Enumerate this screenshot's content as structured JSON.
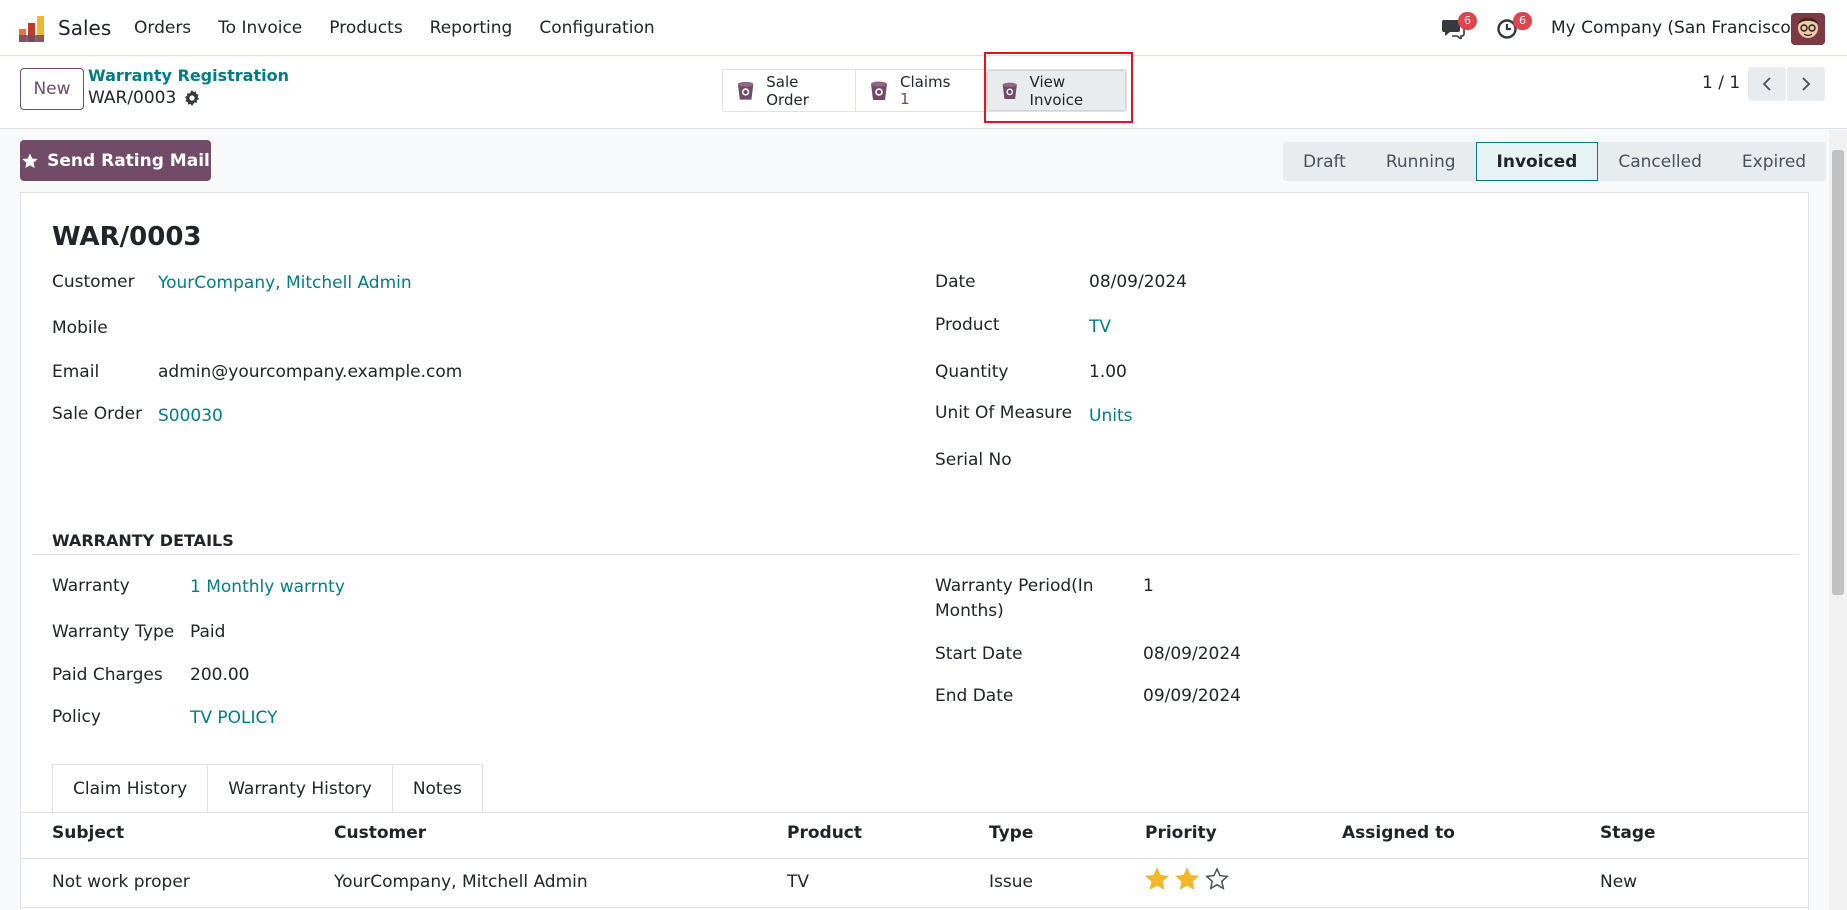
{
  "navbar": {
    "app_name": "Sales",
    "menu": [
      "Orders",
      "To Invoice",
      "Products",
      "Reporting",
      "Configuration"
    ],
    "messages_count": "6",
    "activities_count": "6",
    "company": "My Company (San Francisco)"
  },
  "control": {
    "new_label": "New",
    "breadcrumb_parent": "Warranty Registration",
    "breadcrumb_current": "WAR/0003",
    "smart_buttons": {
      "sale_order": "Sale Order",
      "claims_label": "Claims",
      "claims_count": "1",
      "view_invoice": "View Invoice"
    },
    "pager": "1 / 1"
  },
  "actions": {
    "send_rating_mail": "Send Rating Mail"
  },
  "statusbar": {
    "stages": [
      "Draft",
      "Running",
      "Invoiced",
      "Cancelled",
      "Expired"
    ],
    "active": "Invoiced"
  },
  "form": {
    "title": "WAR/0003",
    "left": {
      "customer_label": "Customer",
      "customer_value": "YourCompany, Mitchell Admin",
      "mobile_label": "Mobile",
      "email_label": "Email",
      "email_value": "admin@yourcompany.example.com",
      "sale_order_label": "Sale Order",
      "sale_order_value": "S00030"
    },
    "right": {
      "date_label": "Date",
      "date_value": "08/09/2024",
      "product_label": "Product",
      "product_value": "TV",
      "quantity_label": "Quantity",
      "quantity_value": "1.00",
      "uom_label": "Unit Of Measure",
      "uom_value": "Units",
      "serial_label": "Serial No"
    },
    "warranty_section": "WARRANTY DETAILS",
    "warranty_left": {
      "warranty_label": "Warranty",
      "warranty_value": "1 Monthly warrnty",
      "type_label": "Warranty Type",
      "type_value": "Paid",
      "charges_label": "Paid Charges",
      "charges_value": "200.00",
      "policy_label": "Policy",
      "policy_value": "TV POLICY"
    },
    "warranty_right": {
      "period_label_1": "Warranty Period(In",
      "period_label_2": "Months)",
      "period_value": "1",
      "start_label": "Start Date",
      "start_value": "08/09/2024",
      "end_label": "End Date",
      "end_value": "09/09/2024"
    },
    "tabs": [
      "Claim History",
      "Warranty History",
      "Notes"
    ],
    "table": {
      "headers": [
        "Subject",
        "Customer",
        "Product",
        "Type",
        "Priority",
        "Assigned to",
        "Stage"
      ],
      "rows": [
        {
          "subject": "Not work proper",
          "customer": "YourCompany, Mitchell Admin",
          "product": "TV",
          "type": "Issue",
          "priority": 2,
          "priority_max": 3,
          "assigned_to": "",
          "stage": "New"
        }
      ]
    }
  },
  "colors": {
    "brand": "#714b67",
    "link": "#017e84",
    "badge": "#e0454f",
    "highlight": "#e0141f",
    "star": "#f3b72a"
  }
}
